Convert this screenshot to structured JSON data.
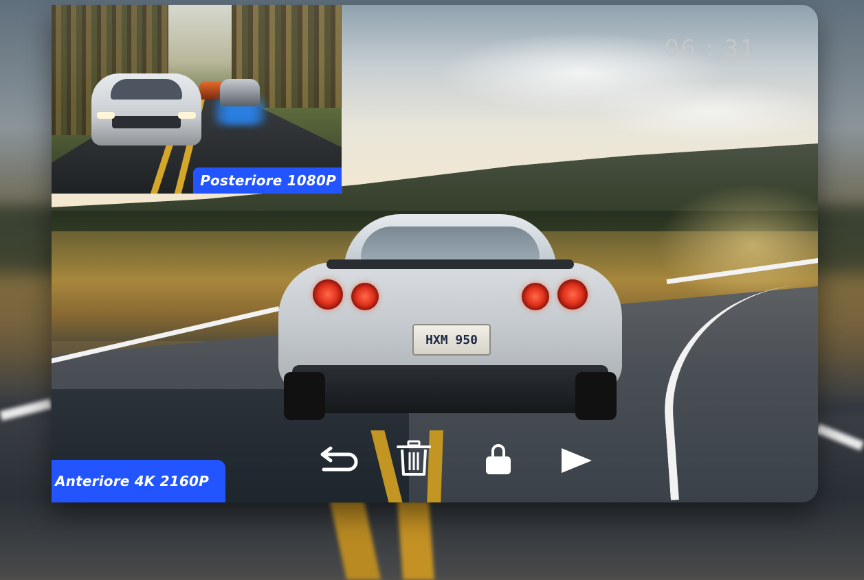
{
  "clock": {
    "time": "06 : 31"
  },
  "cameras": {
    "rear": {
      "label": "Posteriore 1080P"
    },
    "front": {
      "label": "Anteriore 4K  2160P"
    }
  },
  "scene": {
    "plate_text": "HXM 950"
  },
  "controls": [
    {
      "icon": "back-arrow-icon"
    },
    {
      "icon": "trash-icon"
    },
    {
      "icon": "lock-icon"
    },
    {
      "icon": "play-icon"
    }
  ],
  "colors": {
    "label_bg": "#2255ff",
    "label_text": "#ffffff",
    "icon": "#ffffff",
    "clock": "#c8c8c8"
  }
}
